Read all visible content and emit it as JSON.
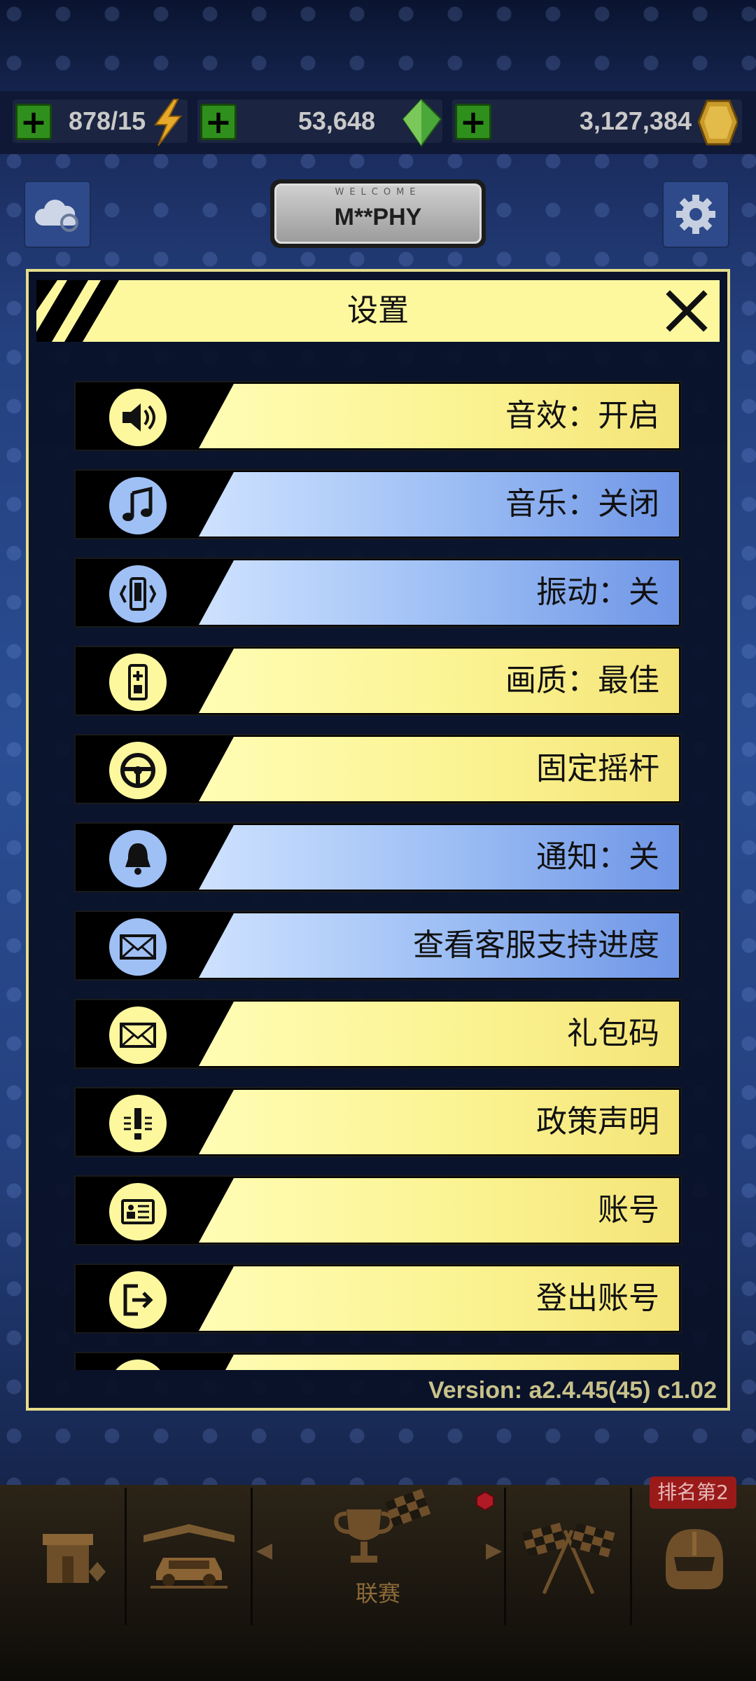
{
  "currency_bar": {
    "energy": {
      "value": "878/15",
      "icon": "lightning-icon"
    },
    "gems": {
      "value": "53,648",
      "icon": "gem-icon"
    },
    "coins": {
      "value": "3,127,384",
      "icon": "coin-icon"
    }
  },
  "header": {
    "welcome_text": "WELCOME",
    "player_name": "M**PHY",
    "cloud_sync_icon": "cloud-sync-icon",
    "settings_icon": "gear-icon"
  },
  "settings_dialog": {
    "title": "设置",
    "close_icon": "close-icon",
    "items": [
      {
        "label": "音效：开启",
        "icon": "speaker-icon",
        "theme": "yellow"
      },
      {
        "label": "音乐：关闭",
        "icon": "music-note-icon",
        "theme": "blue"
      },
      {
        "label": "振动：关",
        "icon": "vibration-icon",
        "theme": "blue"
      },
      {
        "label": "画质：最佳",
        "icon": "graphics-quality-icon",
        "theme": "yellow"
      },
      {
        "label": "固定摇杆",
        "icon": "steering-wheel-icon",
        "theme": "yellow"
      },
      {
        "label": "通知：关",
        "icon": "bell-icon",
        "theme": "blue"
      },
      {
        "label": "查看客服支持进度",
        "icon": "mail-icon",
        "theme": "blue"
      },
      {
        "label": "礼包码",
        "icon": "mail-icon",
        "theme": "yellow"
      },
      {
        "label": "政策声明",
        "icon": "exclamation-icon",
        "theme": "yellow"
      },
      {
        "label": "账号",
        "icon": "id-card-icon",
        "theme": "yellow"
      },
      {
        "label": "登出账号",
        "icon": "logout-icon",
        "theme": "yellow"
      }
    ],
    "version": "Version: a2.4.45(45) c1.02"
  },
  "bottom_nav": {
    "center_label": "联赛",
    "rank_badge": "排名第2",
    "colors": {
      "accent": "#fdf89e",
      "blue_band": "#9fc0f5"
    }
  }
}
